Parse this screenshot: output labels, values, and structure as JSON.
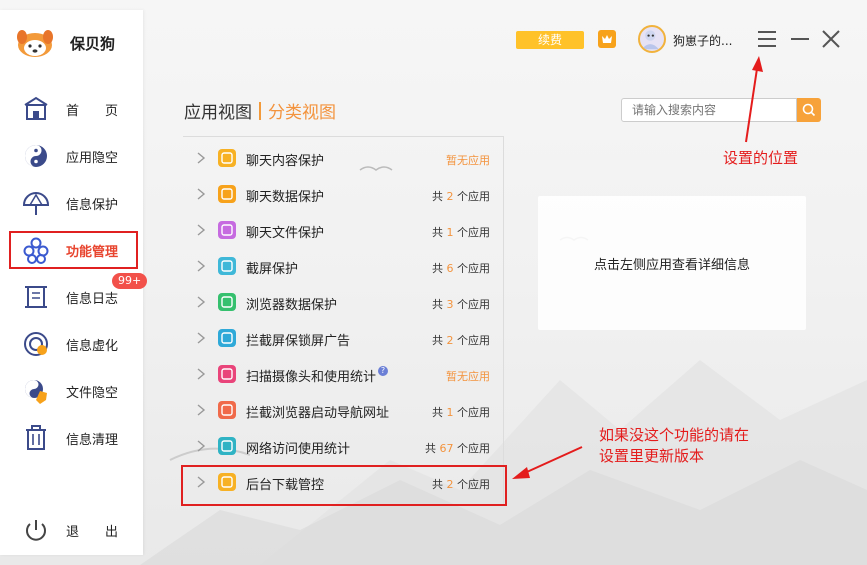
{
  "app": {
    "name": "保贝狗"
  },
  "header": {
    "renew_label": "续费",
    "username": "狗崽子的...",
    "icons": [
      "crown-icon",
      "menu-icon",
      "minimize-icon",
      "close-icon"
    ]
  },
  "sidebar": {
    "items": [
      {
        "label": "首　　页",
        "icon": "home-icon"
      },
      {
        "label": "应用隐空",
        "icon": "yin-yang-icon"
      },
      {
        "label": "信息保护",
        "icon": "umbrella-icon"
      },
      {
        "label": "功能管理",
        "icon": "flower-icon",
        "active": true
      },
      {
        "label": "信息日志",
        "icon": "scroll-icon",
        "badge": "99+"
      },
      {
        "label": "信息虚化",
        "icon": "target-icon"
      },
      {
        "label": "文件隐空",
        "icon": "yin-yang-shield-icon"
      },
      {
        "label": "信息清理",
        "icon": "trash-icon"
      }
    ],
    "logout_label": "退　　出"
  },
  "main": {
    "tabs": {
      "app_view": "应用视图",
      "category_view": "分类视图"
    },
    "search_placeholder": "请输入搜索内容",
    "categories": [
      {
        "name": "聊天内容保护",
        "count_text": "暂无应用",
        "color": "#f7b124"
      },
      {
        "name": "聊天数据保护",
        "count_prefix": "共 ",
        "count": "2",
        "count_suffix": " 个应用",
        "color": "#f7a21b"
      },
      {
        "name": "聊天文件保护",
        "count_prefix": "共 ",
        "count": "1",
        "count_suffix": " 个应用",
        "color": "#c66be0"
      },
      {
        "name": "截屏保护",
        "count_prefix": "共 ",
        "count": "6",
        "count_suffix": " 个应用",
        "color": "#3fb8d8"
      },
      {
        "name": "浏览器数据保护",
        "count_prefix": "共 ",
        "count": "3",
        "count_suffix": " 个应用",
        "color": "#35c06e"
      },
      {
        "name": "拦截屏保锁屏广告",
        "count_prefix": "共 ",
        "count": "2",
        "count_suffix": " 个应用",
        "color": "#2fa9d8"
      },
      {
        "name": "扫描摄像头和使用统计",
        "count_text": "暂无应用",
        "color": "#e9447a",
        "help": "?"
      },
      {
        "name": "拦截浏览器启动导航网址",
        "count_prefix": "共 ",
        "count": "1",
        "count_suffix": " 个应用",
        "color": "#f06a4a"
      },
      {
        "name": "网络访问使用统计",
        "count_prefix": "共 ",
        "count": "67",
        "count_suffix": " 个应用",
        "color": "#2fb3c4"
      },
      {
        "name": "后台下载管控",
        "count_prefix": "共 ",
        "count": "2",
        "count_suffix": " 个应用",
        "color": "#f7b124"
      }
    ],
    "detail_text": "点击左侧应用查看详细信息"
  },
  "annotations": {
    "settings_location": "设置的位置",
    "update_hint_line1": "如果没这个功能的请在",
    "update_hint_line2": "设置里更新版本"
  },
  "colors": {
    "accent": "#f3933d",
    "annotation_red": "#e41c1c",
    "badge": "#f2514a",
    "renew": "#ffc229"
  }
}
